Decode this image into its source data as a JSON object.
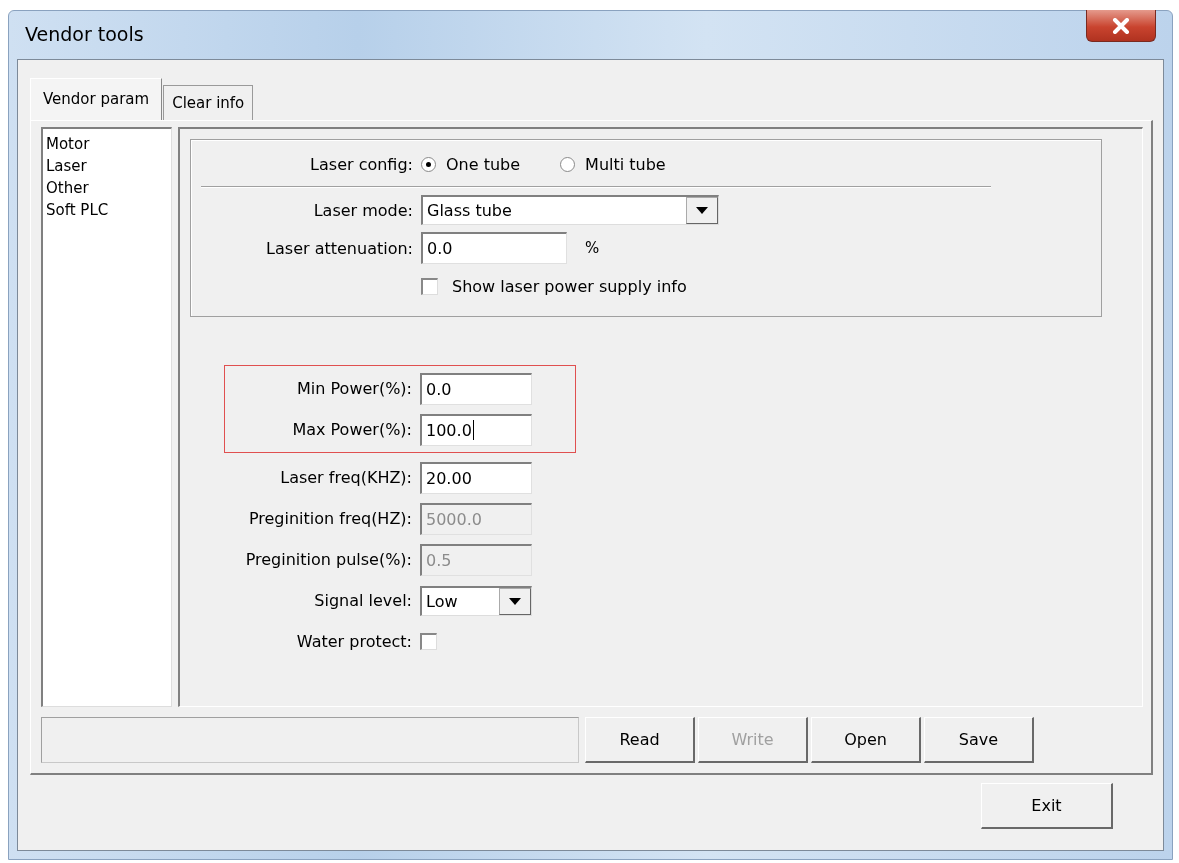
{
  "window": {
    "title": "Vendor tools"
  },
  "tabs": [
    {
      "label": "Vendor param",
      "selected": true
    },
    {
      "label": "Clear info",
      "selected": false
    }
  ],
  "sidebar": {
    "items": [
      {
        "label": "Motor",
        "selected": false
      },
      {
        "label": "Laser",
        "selected": false
      },
      {
        "label": "Other",
        "selected": false
      },
      {
        "label": "Soft PLC",
        "selected": false
      }
    ]
  },
  "laser_group": {
    "laser_config": {
      "label": "Laser config:",
      "options": [
        {
          "label": "One tube",
          "selected": true
        },
        {
          "label": "Multi tube",
          "selected": false
        }
      ]
    },
    "laser_mode": {
      "label": "Laser mode:",
      "value": "Glass tube"
    },
    "laser_attenuation": {
      "label": "Laser attenuation:",
      "value": "0.0",
      "unit": "%"
    },
    "show_power_supply": {
      "label": "Show laser power supply info",
      "checked": false
    }
  },
  "highlighted_fields": [
    {
      "kind": "input",
      "label": "Min Power(%):",
      "value": "0.0",
      "disabled": false,
      "focused": false
    },
    {
      "kind": "input",
      "label": "Max Power(%):",
      "value": "100.0",
      "disabled": false,
      "focused": true
    }
  ],
  "fields": [
    {
      "kind": "input",
      "label": "Laser freq(KHZ):",
      "value": "20.00",
      "disabled": false,
      "focused": false
    },
    {
      "kind": "input",
      "label": "Preginition freq(HZ):",
      "value": "5000.0",
      "disabled": true,
      "focused": false
    },
    {
      "kind": "input",
      "label": "Preginition pulse(%):",
      "value": "0.5",
      "disabled": true,
      "focused": false
    },
    {
      "kind": "select",
      "label": "Signal level:",
      "value": "Low"
    },
    {
      "kind": "checkbox",
      "label": "Water protect:",
      "checked": false
    }
  ],
  "buttons": [
    {
      "label": "Read",
      "disabled": false
    },
    {
      "label": "Write",
      "disabled": true
    },
    {
      "label": "Open",
      "disabled": false
    },
    {
      "label": "Save",
      "disabled": false
    }
  ],
  "exit_button": {
    "label": "Exit"
  }
}
